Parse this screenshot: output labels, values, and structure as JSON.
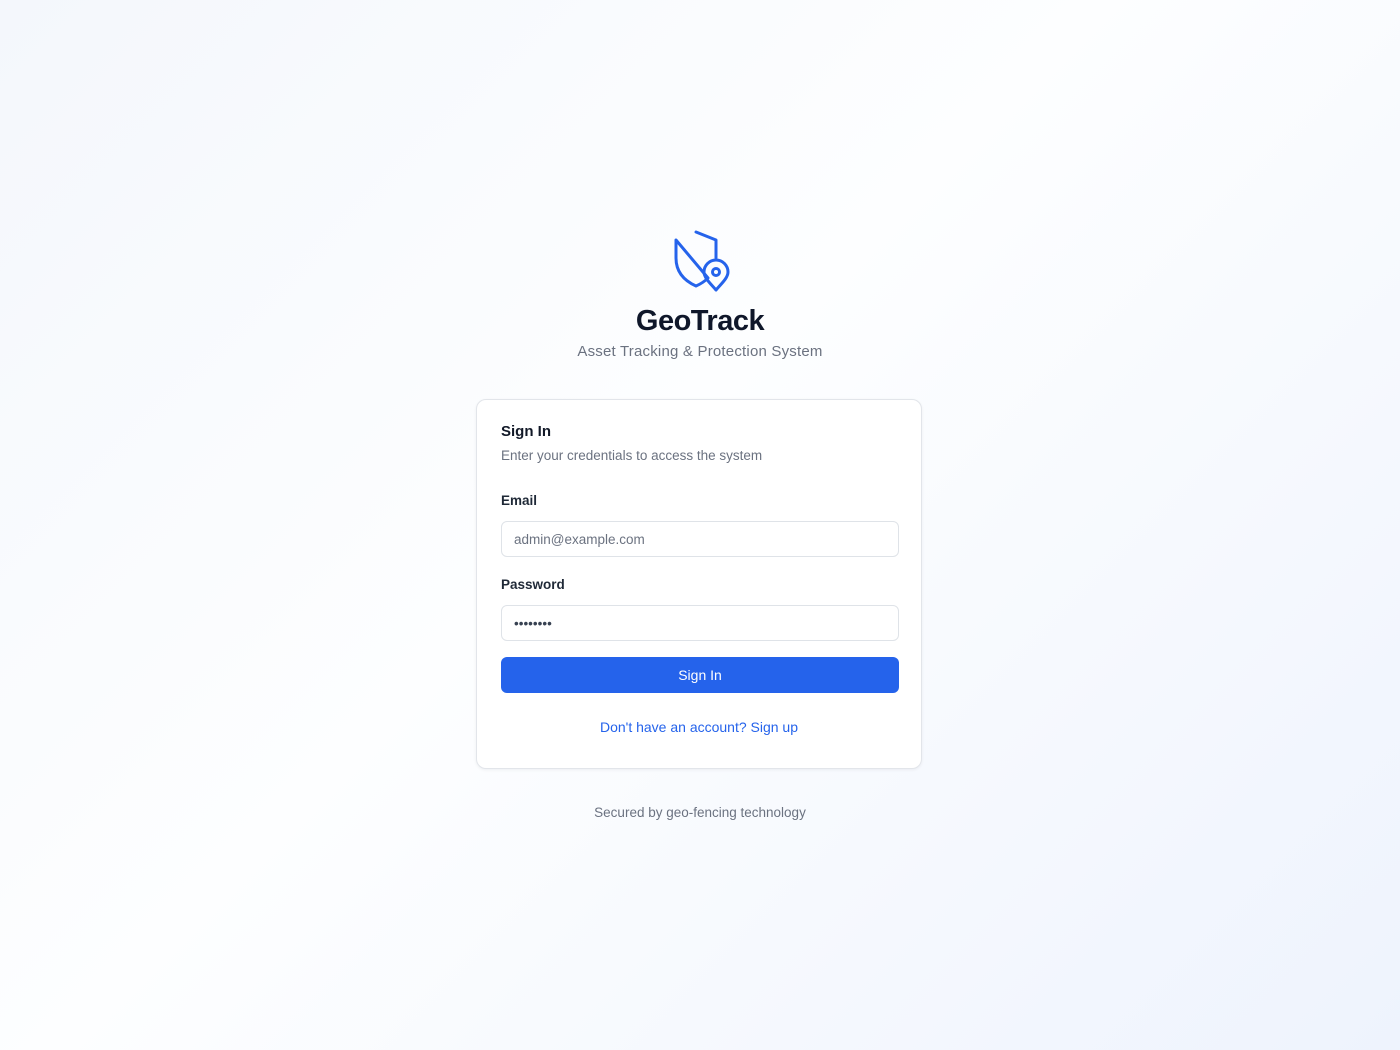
{
  "brand": {
    "name": "GeoTrack",
    "tagline": "Asset Tracking & Protection System",
    "logo_icon": "shield-location-icon",
    "accent_color": "#2563eb"
  },
  "signin_card": {
    "title": "Sign In",
    "description": "Enter your credentials to access the system",
    "email": {
      "label": "Email",
      "placeholder": "admin@example.com",
      "value": ""
    },
    "password": {
      "label": "Password",
      "value": "••••••••"
    },
    "submit_label": "Sign In",
    "signup_link": "Don't have an account? Sign up"
  },
  "footer": {
    "note": "Secured by geo-fencing technology"
  }
}
